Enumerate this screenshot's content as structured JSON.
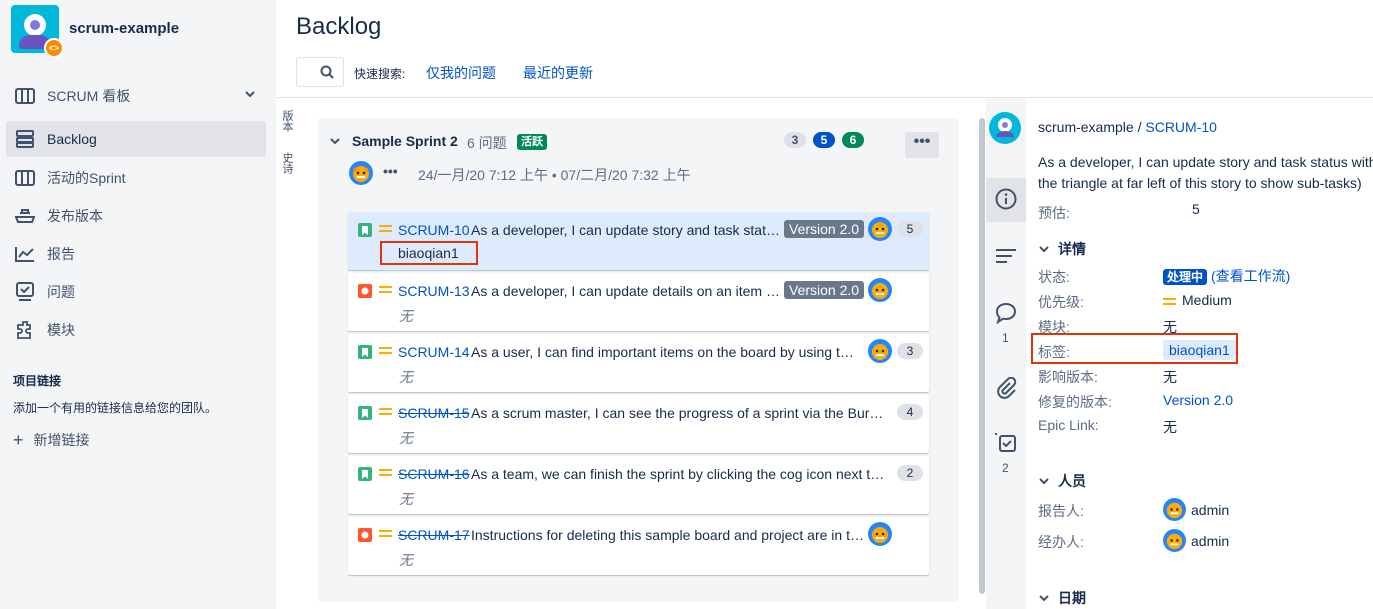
{
  "sidebar": {
    "project_name": "scrum-example",
    "nav": [
      {
        "label": "SCRUM 看板",
        "icon": "board-icon"
      },
      {
        "label": "Backlog",
        "icon": "backlog-icon"
      },
      {
        "label": "活动的Sprint",
        "icon": "active-sprint-icon"
      },
      {
        "label": "发布版本",
        "icon": "release-icon"
      },
      {
        "label": "报告",
        "icon": "reports-icon"
      },
      {
        "label": "问题",
        "icon": "issues-icon"
      },
      {
        "label": "模块",
        "icon": "components-icon"
      }
    ],
    "links_title": "项目链接",
    "links_desc": "添加一个有用的链接信息给您的团队。",
    "add_link": "新增链接"
  },
  "header": {
    "title": "Backlog",
    "quick_search_label": "快速搜索:",
    "quick_filters": [
      "仅我的问题",
      "最近的更新"
    ]
  },
  "side_tabs": [
    "版本",
    "史诗"
  ],
  "sprint": {
    "name": "Sample Sprint 2",
    "issue_count": "6 问题",
    "status": "活跃",
    "counts": [
      {
        "value": "3",
        "color": "#dfe1e6",
        "text_color": "#42526e"
      },
      {
        "value": "5",
        "color": "#0052cc",
        "text_color": "#ffffff"
      },
      {
        "value": "6",
        "color": "#00875a",
        "text_color": "#ffffff"
      }
    ],
    "more": "•••",
    "dates": "24/一月/20 7:12 上午 • 07/二月/20 7:32 上午",
    "dots": "•••"
  },
  "issues": [
    {
      "key": "SCRUM-10",
      "type": "story",
      "done": false,
      "summary": "As a developer, I can update story and task status with the triangle at far left of this story to show sub-tasks)",
      "version": "Version 2.0",
      "points": "5",
      "label": "biaoqian1",
      "selected": true
    },
    {
      "key": "SCRUM-13",
      "type": "bug",
      "done": false,
      "summary": "As a developer, I can update details on an item using the Detail View",
      "version": "Version 2.0",
      "points": "",
      "none": "无"
    },
    {
      "key": "SCRUM-14",
      "type": "story",
      "done": false,
      "summary": "As a user, I can find important items on the board by using the customisable Quick Filters",
      "version": "",
      "points": "3",
      "none": "无"
    },
    {
      "key": "SCRUM-15",
      "type": "story",
      "done": true,
      "summary": "As a scrum master, I can see the progress of a sprint via the Burndown Chart",
      "version": "",
      "points": "4",
      "none": "无"
    },
    {
      "key": "SCRUM-16",
      "type": "story",
      "done": true,
      "summary": "As a team, we can finish the sprint by clicking the cog icon next to the sprint name",
      "version": "",
      "points": "2",
      "none": "无"
    },
    {
      "key": "SCRUM-17",
      "type": "bug",
      "done": true,
      "summary": "Instructions for deleting this sample board and project are in the description",
      "version": "",
      "points": "",
      "none": "无"
    }
  ],
  "detail": {
    "breadcrumb_project": "scrum-example",
    "breadcrumb_sep": "/",
    "breadcrumb_key": "SCRUM-10",
    "summary": "As a developer, I can update story and task status with the triangle at far left of this story to show sub-tasks)",
    "estimate_label": "预估:",
    "estimate_value": "5",
    "details_title": "详情",
    "status_label": "状态:",
    "status_value": "处理中",
    "status_link": "(查看工作流)",
    "priority_label": "优先级:",
    "priority_value": "Medium",
    "component_label": "模块:",
    "component_value": "无",
    "labels_label": "标签:",
    "labels_value": "biaoqian1",
    "affects_label": "影响版本:",
    "affects_value": "无",
    "fix_label": "修复的版本:",
    "fix_value": "Version 2.0",
    "epic_label": "Epic Link:",
    "epic_value": "无",
    "people_title": "人员",
    "reporter_label": "报告人:",
    "reporter_value": "admin",
    "assignee_label": "经办人:",
    "assignee_value": "admin",
    "dates_title": "日期",
    "comments_count": "1",
    "subtasks_count": "2"
  }
}
